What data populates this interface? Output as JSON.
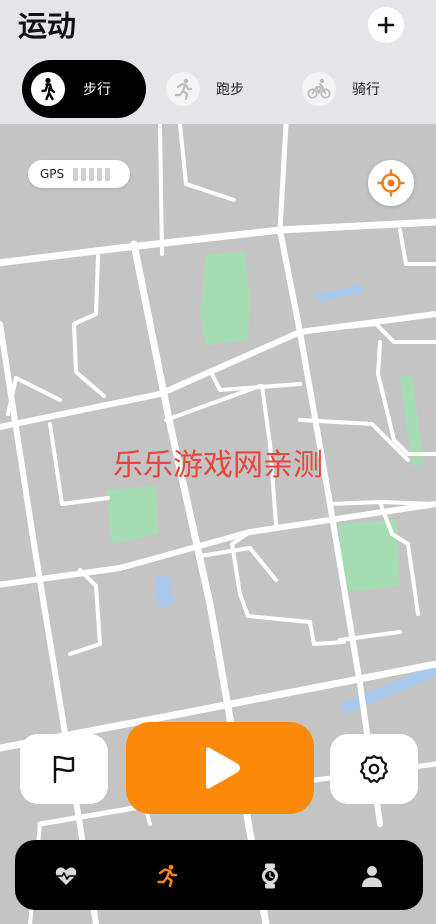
{
  "header": {
    "title": "运动",
    "add_icon": "plus-icon"
  },
  "tabs": [
    {
      "label": "步行",
      "icon": "walk-icon",
      "active": true
    },
    {
      "label": "跑步",
      "icon": "run-icon",
      "active": false
    },
    {
      "label": "骑行",
      "icon": "bike-icon",
      "active": false
    }
  ],
  "map": {
    "gps_label": "GPS",
    "gps_signal_bars": 5,
    "locate_icon": "crosshair-icon",
    "watermark": "乐乐游戏网亲测"
  },
  "actions": {
    "flag_icon": "flag-icon",
    "start_icon": "play-icon",
    "settings_icon": "gear-icon"
  },
  "bottom_nav": [
    {
      "icon": "heart-pulse-icon",
      "active": false
    },
    {
      "icon": "running-person-icon",
      "active": true
    },
    {
      "icon": "watch-icon",
      "active": false
    },
    {
      "icon": "person-icon",
      "active": false
    }
  ],
  "colors": {
    "accent": "#fb8a0a",
    "map_background": "#c4c4c4",
    "park_green": "#a6dcb2",
    "water_blue": "#a8c8ec",
    "nav_background": "#000000"
  }
}
